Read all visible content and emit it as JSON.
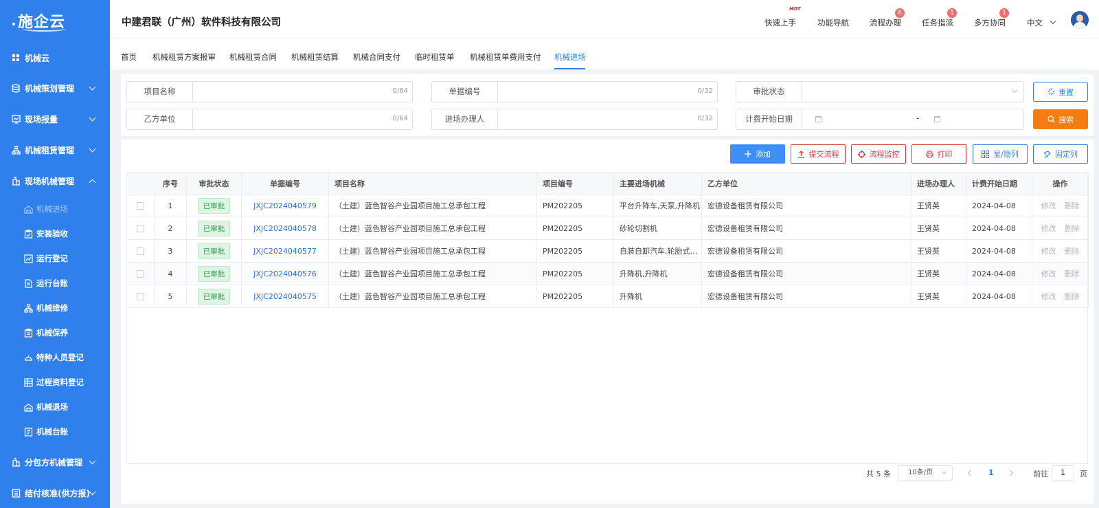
{
  "app": {
    "logo_text": "施企云",
    "company": "中建君联（广州）软件科技有限公司"
  },
  "header": {
    "quick_start": "快速上手",
    "hot_badge": "HOT",
    "func_nav": "功能导航",
    "process": "流程办理",
    "process_badge": "8",
    "task": "任务指派",
    "task_badge": "1",
    "collab": "多方协同",
    "collab_badge": "1",
    "language": "中文"
  },
  "sidebar": {
    "home": "机械云",
    "groups": [
      {
        "label": "机械策划管理"
      },
      {
        "label": "现场报量"
      },
      {
        "label": "机械租赁管理"
      },
      {
        "label": "现场机械管理"
      }
    ],
    "sub_items": [
      {
        "label": "机械进场"
      },
      {
        "label": "安装验收"
      },
      {
        "label": "运行登记"
      },
      {
        "label": "运行台账"
      },
      {
        "label": "机械维修"
      },
      {
        "label": "机械保养"
      },
      {
        "label": "特种人员登记"
      },
      {
        "label": "过程资料登记"
      },
      {
        "label": "机械退场"
      },
      {
        "label": "机械台账"
      }
    ],
    "bottom_groups": [
      {
        "label": "分包方机械管理"
      },
      {
        "label": "结付核准(供方报)"
      }
    ]
  },
  "tabs": [
    "首页",
    "机械租赁方案报审",
    "机械租赁合同",
    "机械租赁结算",
    "机械合同支付",
    "临时租赁单",
    "机械租赁单费用支付",
    "机械进场"
  ],
  "filters": {
    "project_name": {
      "label": "项目名称",
      "count": "0/64"
    },
    "doc_no": {
      "label": "单据编号",
      "count": "0/32"
    },
    "approval_status": {
      "label": "审批状态"
    },
    "party_b": {
      "label": "乙方单位",
      "count": "0/64"
    },
    "handler": {
      "label": "进场办理人",
      "count": "0/32"
    },
    "start_date": {
      "label": "计费开始日期",
      "separator": "-"
    },
    "reset": "重置",
    "search": "搜索"
  },
  "toolbar": {
    "add": "添加",
    "submit_flow": "提交流程",
    "monitor_flow": "流程监控",
    "print": "打印",
    "toggle_cols": "显/隐列",
    "fix_cols": "固定列"
  },
  "table": {
    "headers": [
      "序号",
      "审批状态",
      "单据编号",
      "项目名称",
      "项目编号",
      "主要进场机械",
      "乙方单位",
      "进场办理人",
      "计费开始日期",
      "操作"
    ],
    "rows": [
      {
        "seq": "1",
        "status": "已审批",
        "doc_no": "JXJC2024040579",
        "project": "（土建）蓝色智谷产业园项目施工总承包工程",
        "proj_no": "PM202205",
        "machines": "平台升降车,天泵,升降机",
        "party_b": "宏德设备租赁有限公司",
        "handler": "王贤英",
        "date": "2024-04-08",
        "edit": "修改",
        "del": "删除"
      },
      {
        "seq": "2",
        "status": "已审批",
        "doc_no": "JXJC2024040578",
        "project": "（土建）蓝色智谷产业园项目施工总承包工程",
        "proj_no": "PM202205",
        "machines": "砂轮切割机",
        "party_b": "宏德设备租赁有限公司",
        "handler": "王贤英",
        "date": "2024-04-08",
        "edit": "修改",
        "del": "删除"
      },
      {
        "seq": "3",
        "status": "已审批",
        "doc_no": "JXJC2024040577",
        "project": "（土建）蓝色智谷产业园项目施工总承包工程",
        "proj_no": "PM202205",
        "machines": "自装自卸汽车,轮胎式装载机",
        "party_b": "宏德设备租赁有限公司",
        "handler": "王贤英",
        "date": "2024-04-08",
        "edit": "修改",
        "del": "删除"
      },
      {
        "seq": "4",
        "status": "已审批",
        "doc_no": "JXJC2024040576",
        "project": "（土建）蓝色智谷产业园项目施工总承包工程",
        "proj_no": "PM202205",
        "machines": "升降机,升降机",
        "party_b": "宏德设备租赁有限公司",
        "handler": "王贤英",
        "date": "2024-04-08",
        "edit": "修改",
        "del": "删除"
      },
      {
        "seq": "5",
        "status": "已审批",
        "doc_no": "JXJC2024040575",
        "project": "（土建）蓝色智谷产业园项目施工总承包工程",
        "proj_no": "PM202205",
        "machines": "升降机",
        "party_b": "宏德设备租赁有限公司",
        "handler": "王贤英",
        "date": "2024-04-08",
        "edit": "修改",
        "del": "删除"
      }
    ]
  },
  "pagination": {
    "total": "共 5 条",
    "page_size": "10条/页",
    "current": "1",
    "goto_label": "前往",
    "goto_value": "1",
    "page_unit": "页"
  },
  "colors": {
    "sidebar": "#2f80ed",
    "accent": "#2f80ed",
    "search": "#f57c10",
    "danger": "#d9363e",
    "approved": "#1e9b48"
  }
}
